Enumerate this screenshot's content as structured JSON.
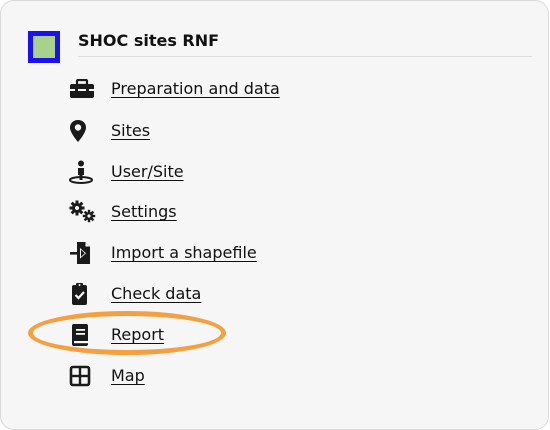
{
  "layer": {
    "title": "SHOC sites RNF",
    "swatch_fill": "#a9d18e",
    "swatch_border": "#1d10f0"
  },
  "menu": {
    "items": [
      {
        "label": "Preparation and data",
        "icon": "toolbox-icon"
      },
      {
        "label": "Sites",
        "icon": "map-marker-icon"
      },
      {
        "label": "User/Site",
        "icon": "person-location-icon"
      },
      {
        "label": "Settings",
        "icon": "gears-icon"
      },
      {
        "label": "Import a shapefile",
        "icon": "file-import-icon"
      },
      {
        "label": "Check data",
        "icon": "clipboard-check-icon"
      },
      {
        "label": "Report",
        "icon": "book-icon"
      },
      {
        "label": "Map",
        "icon": "grid-icon"
      }
    ]
  },
  "highlight": {
    "target": "Report",
    "color": "#f4a041"
  }
}
